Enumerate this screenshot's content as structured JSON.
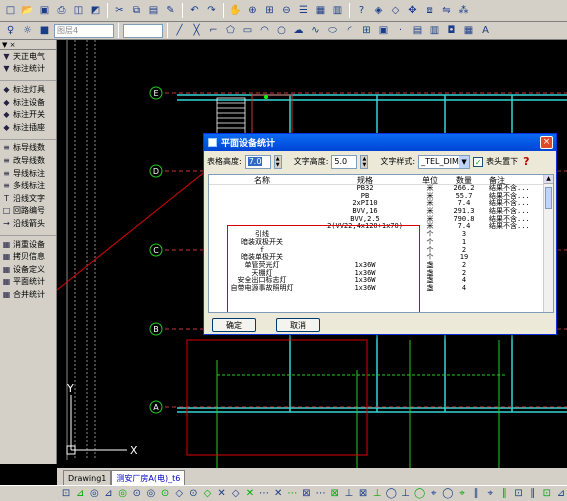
{
  "toolbar1": {
    "icons": [
      "new-file-icon",
      "open-icon",
      "save-icon",
      "print-icon",
      "preview-icon",
      "plot-icon",
      "cut-icon",
      "copy-icon",
      "paste-icon",
      "match-prop-icon",
      "undo-icon",
      "redo-icon",
      "pan-icon",
      "zoom-realtime-icon",
      "zoom-window-icon",
      "zoom-previous-icon",
      "properties-icon",
      "design-center-icon",
      "tool-palette-icon",
      "help-icon",
      "layer-icon",
      "layer-prev-icon",
      "move-icon",
      "copy-obj-icon",
      "mirror-icon",
      "array-icon"
    ]
  },
  "toolbar2": {
    "layer_combo": "图层4"
  },
  "palette": {
    "header": "▼ ×",
    "items": [
      {
        "icon": "▼",
        "label": "天正电气"
      },
      {
        "icon": "▼",
        "label": "标注统计"
      },
      {
        "icon": "",
        "label": ""
      },
      {
        "icon": "◆",
        "label": "标注灯具"
      },
      {
        "icon": "◆",
        "label": "标注设备"
      },
      {
        "icon": "◆",
        "label": "标注开关"
      },
      {
        "icon": "◆",
        "label": "标注插座"
      },
      {
        "icon": "",
        "label": ""
      },
      {
        "icon": "≡",
        "label": "标导线数"
      },
      {
        "icon": "≡",
        "label": "改导线数"
      },
      {
        "icon": "≡",
        "label": "导线标注"
      },
      {
        "icon": "≡",
        "label": "多线标注"
      },
      {
        "icon": "T",
        "label": "沿线文字"
      },
      {
        "icon": "□",
        "label": "回路编号"
      },
      {
        "icon": "→",
        "label": "沿线箭头"
      },
      {
        "icon": "",
        "label": ""
      },
      {
        "icon": "▦",
        "label": "消重设备"
      },
      {
        "icon": "▦",
        "label": "拷贝信息"
      },
      {
        "icon": "▦",
        "label": "设备定义"
      },
      {
        "icon": "▦",
        "label": "平面统计"
      },
      {
        "icon": "▦",
        "label": "合并统计"
      }
    ]
  },
  "canvas": {
    "axis_labels": [
      "E",
      "D",
      "C",
      "B",
      "A"
    ],
    "ucs_x": "X",
    "ucs_y": "Y"
  },
  "tabs": [
    "Drawing1",
    "测安厂房A(电)_t6"
  ],
  "dialog": {
    "title": "平面设备统计",
    "close": "×",
    "table_height_label": "表格高度:",
    "table_height_value": "7.0",
    "text_height_label": "文字高度:",
    "text_height_value": "5.0",
    "text_style_label": "文字样式:",
    "text_style_value": "_TEL_DIM",
    "header_top_label": "表头置下",
    "help": "?",
    "columns": [
      "名称",
      "规格",
      "单位",
      "数量",
      "备注"
    ],
    "rows": [
      [
        "",
        "PB32",
        "米",
        "266.2",
        "结果不含..."
      ],
      [
        "",
        "PB",
        "米",
        "55.7",
        "结果不含..."
      ],
      [
        "",
        "2xPI10",
        "米",
        "7.4",
        "结果不含..."
      ],
      [
        "",
        "BVV,16",
        "米",
        "291.3",
        "结果不含..."
      ],
      [
        "",
        "BVV,2.5",
        "米",
        "790.8",
        "结果不含..."
      ],
      [
        "",
        "2(VV22,4x120+1x70)",
        "米",
        "7.4",
        "结果不含..."
      ],
      [
        "引线",
        "",
        "个",
        "3",
        ""
      ],
      [
        "暗装双极开关",
        "",
        "个",
        "1",
        ""
      ],
      [
        "f",
        "",
        "个",
        "2",
        ""
      ],
      [
        "暗装单极开关",
        "",
        "个",
        "19",
        ""
      ],
      [
        "单管荧光灯",
        "1x36W",
        "盏",
        "2",
        ""
      ],
      [
        "天棚灯",
        "1x36W",
        "盏",
        "2",
        ""
      ],
      [
        "安全出口标志灯",
        "1x36W",
        "盏",
        "4",
        ""
      ],
      [
        "自带电源事故照明灯",
        "1x36W",
        "盏",
        "4",
        ""
      ]
    ],
    "ok": "确定",
    "cancel": "取消"
  },
  "bottom_toolbar": {
    "icons": [
      "osnap-endpoint-icon",
      "osnap-mid-icon",
      "osnap-center-icon",
      "osnap-node-icon",
      "osnap-quad-icon",
      "osnap-intersect-icon",
      "osnap-ext-icon",
      "osnap-insert-icon",
      "osnap-perp-icon",
      "osnap-tangent-icon",
      "osnap-near-icon",
      "osnap-parallel-icon"
    ]
  }
}
